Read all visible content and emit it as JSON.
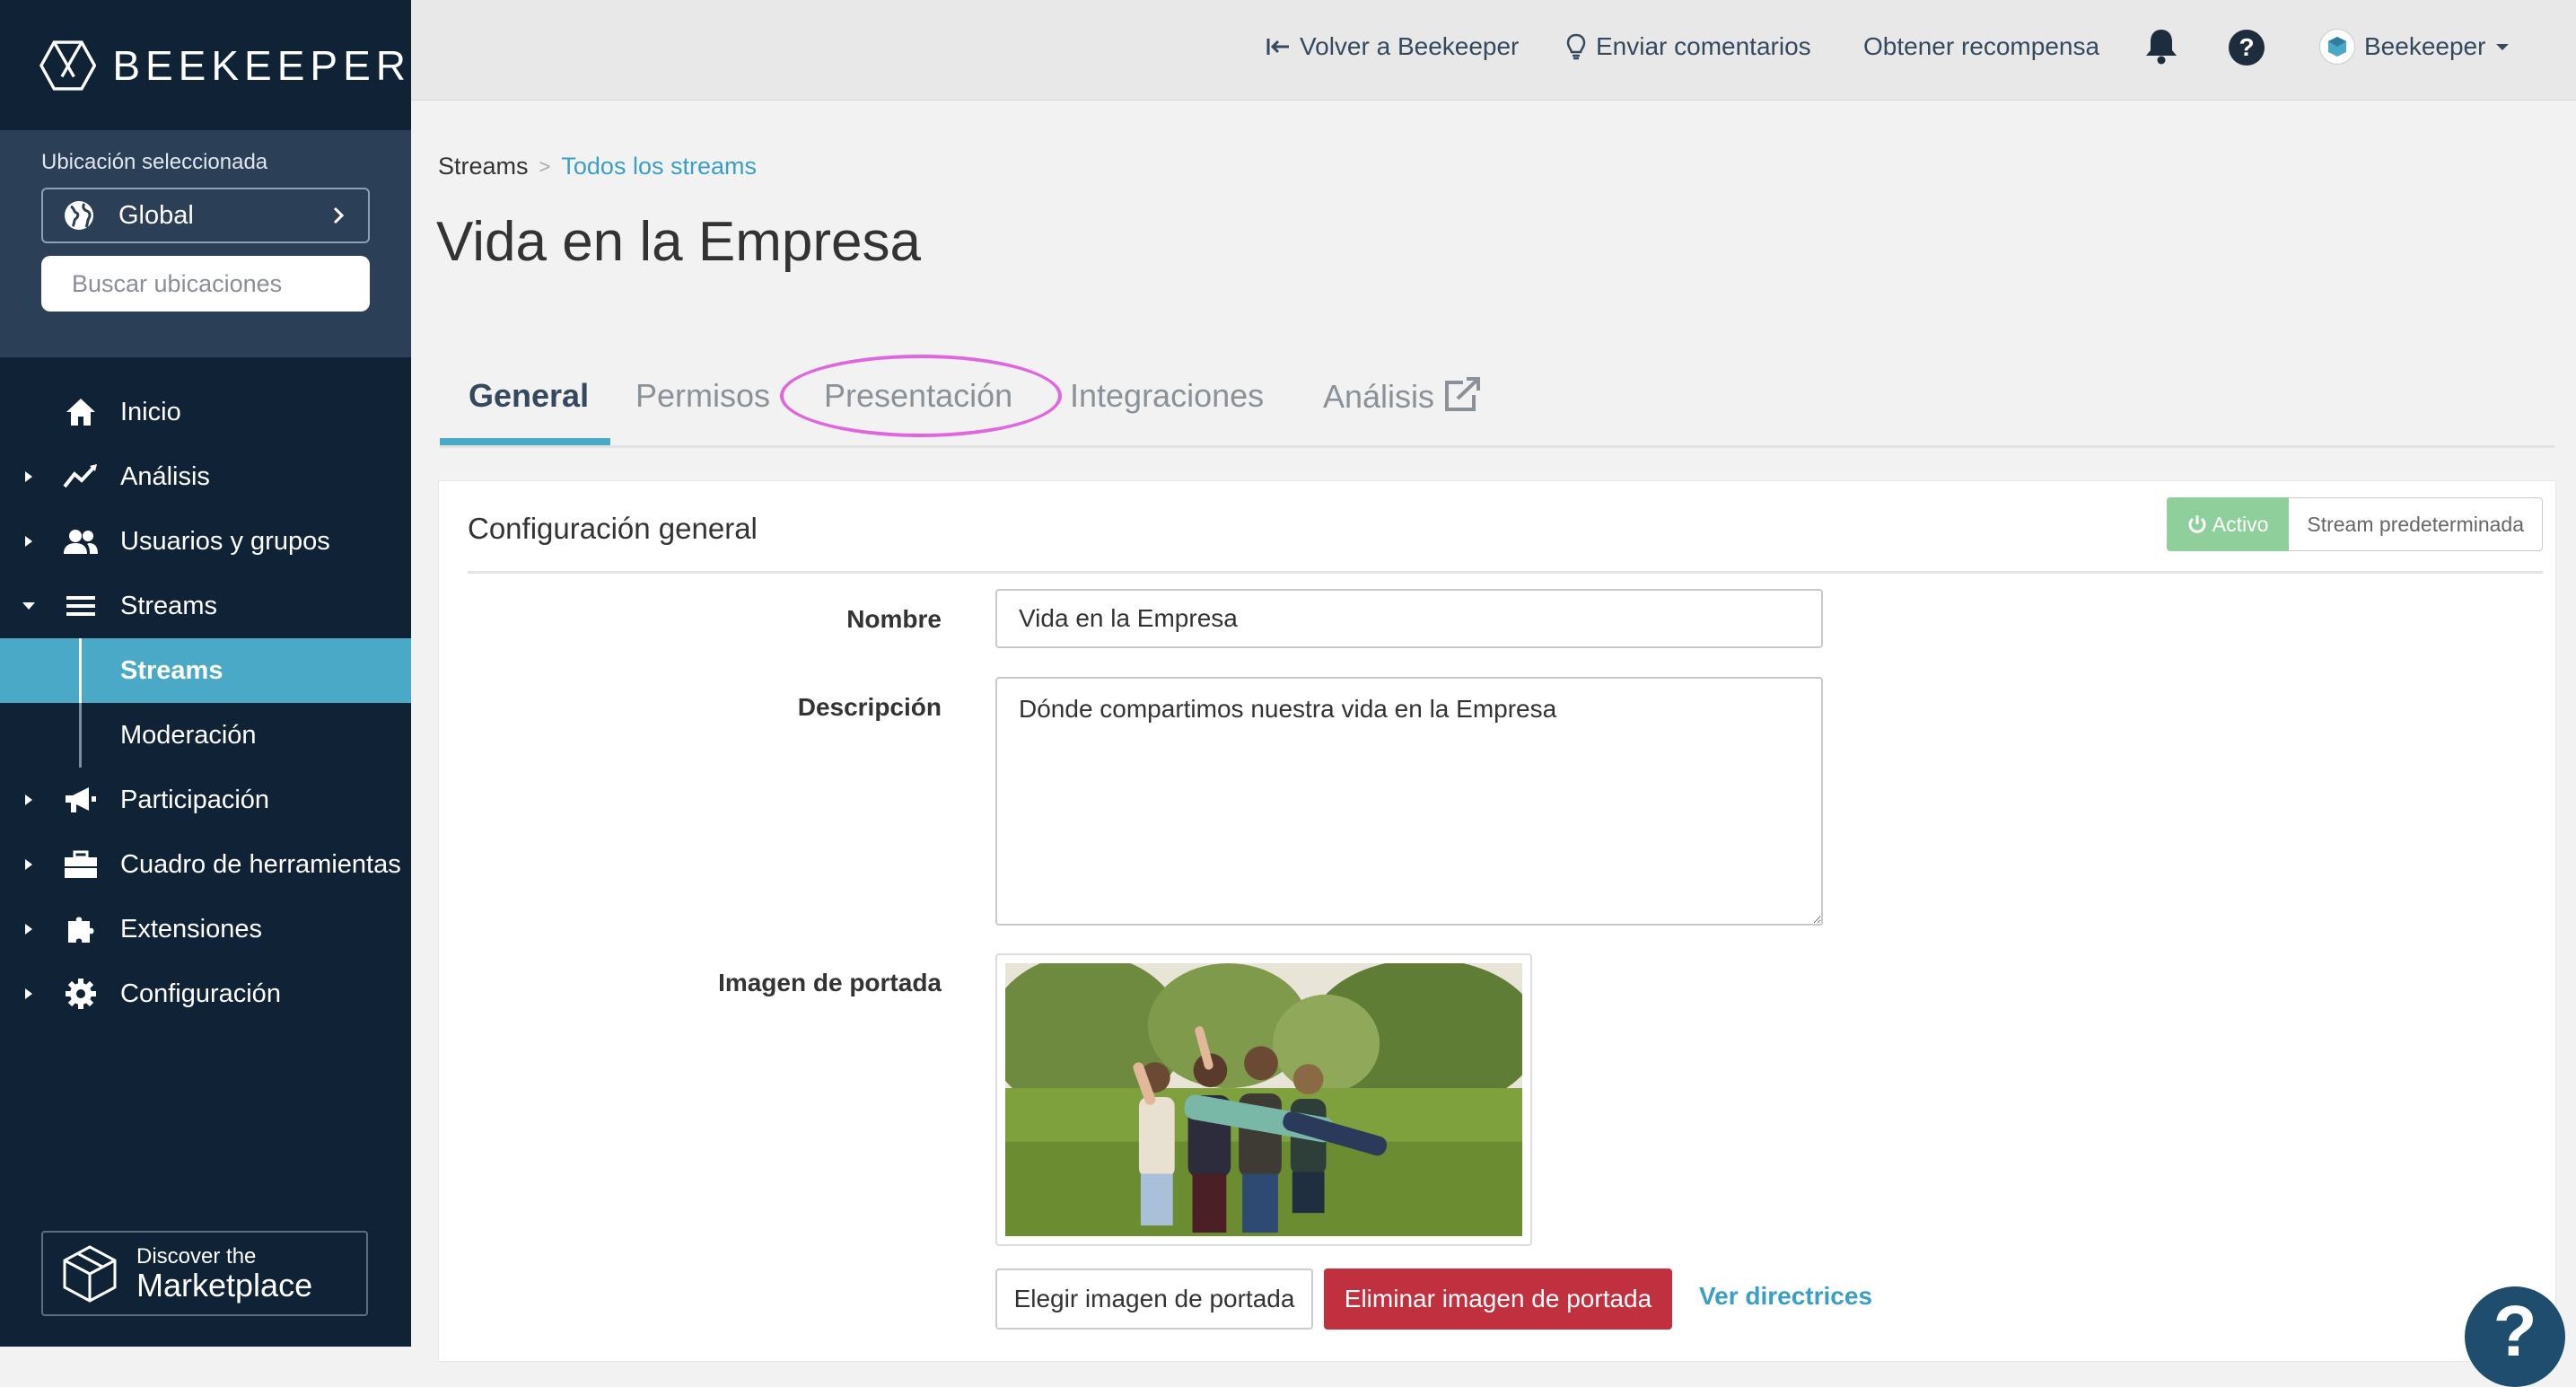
{
  "brand": {
    "name": "BEEKEEPER",
    "icon": "beekeeper-logo-icon"
  },
  "location": {
    "label": "Ubicación seleccionada",
    "selected": "Global",
    "search_placeholder": "Buscar ubicaciones"
  },
  "nav": {
    "items": [
      {
        "label": "Inicio",
        "icon": "home-icon"
      },
      {
        "label": "Análisis",
        "icon": "analytics-icon"
      },
      {
        "label": "Usuarios y grupos",
        "icon": "users-icon"
      },
      {
        "label": "Streams",
        "icon": "streams-icon"
      },
      {
        "label": "Participación",
        "icon": "megaphone-icon"
      },
      {
        "label": "Cuadro de herramientas",
        "icon": "toolbox-icon"
      },
      {
        "label": "Extensiones",
        "icon": "puzzle-icon"
      },
      {
        "label": "Configuración",
        "icon": "gear-icon"
      }
    ],
    "sub_items": [
      {
        "label": "Streams",
        "active": true
      },
      {
        "label": "Moderación",
        "active": false
      }
    ]
  },
  "marketplace": {
    "line1": "Discover the",
    "line2": "Marketplace"
  },
  "topbar": {
    "back": "Volver a Beekeeper",
    "feedback": "Enviar comentarios",
    "reward": "Obtener recompensa",
    "user": "Beekeeper"
  },
  "breadcrumb": {
    "root": "Streams",
    "separator": ">",
    "current": "Todos los streams"
  },
  "page_title": "Vida en la Empresa",
  "tabs": [
    "General",
    "Permisos",
    "Presentación",
    "Integraciones",
    "Análisis"
  ],
  "active_tab": "General",
  "card": {
    "title": "Configuración general",
    "status_active": "Activo",
    "status_default": "Stream predeterminada"
  },
  "form": {
    "name_label": "Nombre",
    "name_value": "Vida en la Empresa",
    "description_label": "Descripción",
    "description_value": "Dónde compartimos nuestra vida en la Empresa",
    "cover_label": "Imagen de portada",
    "choose_cover": "Elegir imagen de portada",
    "remove_cover": "Eliminar imagen de portada",
    "guidelines": "Ver directrices"
  },
  "help": {
    "symbol": "?"
  },
  "colors": {
    "sidebar_bg": "#0f2236",
    "location_panel_bg": "#2b3f57",
    "accent": "#4aa9c6",
    "danger": "#c0303f",
    "active_green": "#8fcf9b",
    "highlight_circle": "#e066e0"
  }
}
